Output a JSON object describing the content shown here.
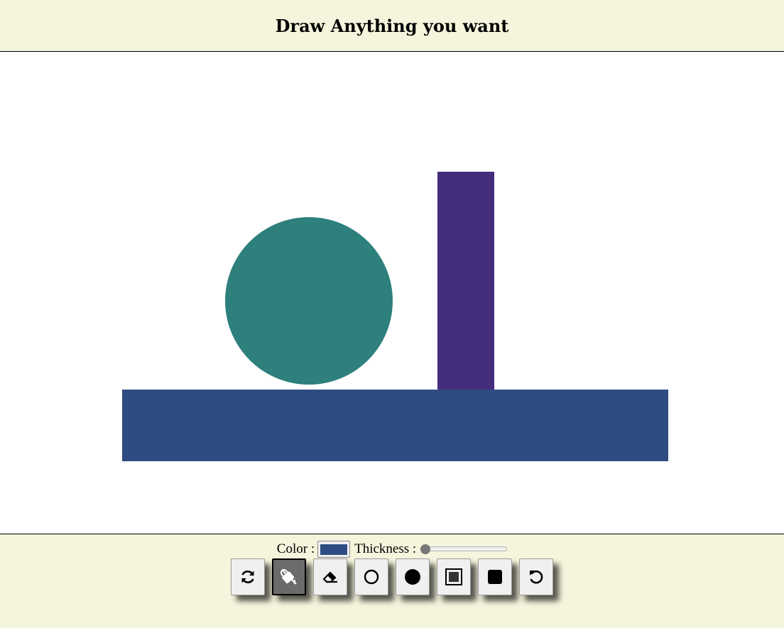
{
  "header": {
    "title": "Draw Anything you want"
  },
  "canvas": {
    "shapes": [
      {
        "name": "circle-shape",
        "color": "#2d807c"
      },
      {
        "name": "vertical-rectangle-shape",
        "color": "#452d7e"
      },
      {
        "name": "horizontal-rectangle-shape",
        "color": "#2e4c82"
      }
    ]
  },
  "controls": {
    "color_label": "Color :",
    "color_value": "#2e4c82",
    "thickness_label": "Thickness :",
    "thickness_value": 0
  },
  "tools": [
    {
      "name": "reset-tool-button",
      "icon": "refresh-icon",
      "active": false
    },
    {
      "name": "fill-tool-button",
      "icon": "paint-bucket-icon",
      "active": true
    },
    {
      "name": "eraser-tool-button",
      "icon": "eraser-icon",
      "active": false
    },
    {
      "name": "circle-outline-tool-button",
      "icon": "circle-outline-icon",
      "active": false
    },
    {
      "name": "circle-filled-tool-button",
      "icon": "circle-filled-icon",
      "active": false
    },
    {
      "name": "square-outline-tool-button",
      "icon": "square-outline-icon",
      "active": false
    },
    {
      "name": "square-filled-tool-button",
      "icon": "square-filled-icon",
      "active": false
    },
    {
      "name": "undo-tool-button",
      "icon": "undo-icon",
      "active": false
    }
  ]
}
